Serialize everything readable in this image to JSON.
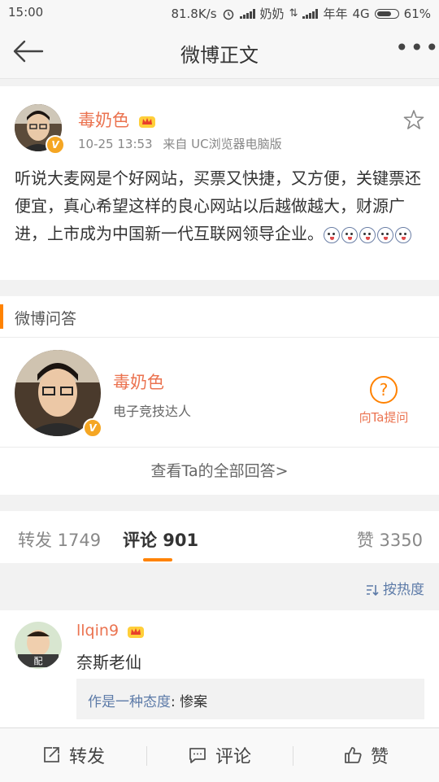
{
  "status_bar": {
    "time": "15:00",
    "speed": "81.8K/s",
    "carrier1": "奶奶",
    "carrier2": "年年",
    "network": "4G",
    "battery": "61%",
    "battery_level": 0.61
  },
  "nav": {
    "title": "微博正文"
  },
  "post": {
    "username": "毒奶色",
    "timestamp": "10-25 13:53",
    "source": "来自 UC浏览器电脑版",
    "content": "听说大麦网是个好网站，买票又快捷，又方便，关键票还便宜，真心希望这样的良心网站以后越做越大，财源广进，上市成为中国新一代互联网领导企业。",
    "emoji_count": 5
  },
  "qa": {
    "section_title": "微博问答",
    "name": "毒奶色",
    "subtitle": "电子竞技达人",
    "ask_label": "向Ta提问",
    "view_all": "查看Ta的全部回答>"
  },
  "tabs": {
    "repost": "转发 1749",
    "comments": "评论 901",
    "likes": "赞 3350"
  },
  "sort": {
    "label": "按热度"
  },
  "comment": {
    "username": "llqin9",
    "text": "奈斯老仙",
    "reply_user": "作是一种态度",
    "reply_text": "惨案"
  },
  "bottom": {
    "repost": "转发",
    "comment": "评论",
    "like": "赞"
  },
  "colors": {
    "accent": "#ff8200",
    "name": "#eb7350",
    "link": "#5d7ba8"
  }
}
